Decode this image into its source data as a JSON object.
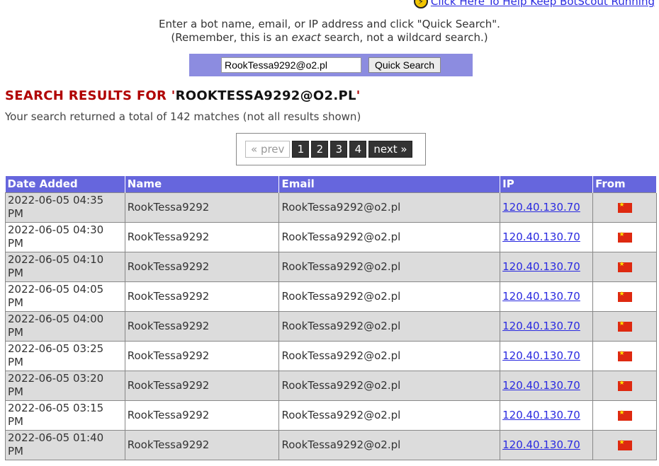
{
  "top": {
    "link_text": "Click Here To Help Keep BotScout Running"
  },
  "instructions": {
    "line1": "Enter a bot name, email, or IP address and click \"Quick Search\".",
    "line2_a": "(Remember, this is an ",
    "line2_em": "exact",
    "line2_b": " search, not a wildcard search.)"
  },
  "search": {
    "value": "RookTessa9292@o2.pl",
    "button_label": "Quick Search"
  },
  "results": {
    "title_label": "SEARCH RESULTS FOR '",
    "title_query": "ROOKTESSA9292@O2.PL",
    "title_end": "'",
    "summary": "Your search returned a total of 142 matches (not all results shown)"
  },
  "pager": {
    "prev": "« prev",
    "pages": [
      "1",
      "2",
      "3",
      "4"
    ],
    "next": "next »"
  },
  "table": {
    "headers": [
      "Date Added",
      "Name",
      "Email",
      "IP",
      "From"
    ],
    "flag_color": "#de2910",
    "rows": [
      {
        "date": "2022-06-05 04:35\nPM",
        "name": "RookTessa9292",
        "email": "RookTessa9292@o2.pl",
        "ip": "120.40.130.70",
        "from": "china-flag-icon"
      },
      {
        "date": "2022-06-05 04:30\nPM",
        "name": "RookTessa9292",
        "email": "RookTessa9292@o2.pl",
        "ip": "120.40.130.70",
        "from": "china-flag-icon"
      },
      {
        "date": "2022-06-05 04:10\nPM",
        "name": "RookTessa9292",
        "email": "RookTessa9292@o2.pl",
        "ip": "120.40.130.70",
        "from": "china-flag-icon"
      },
      {
        "date": "2022-06-05 04:05\nPM",
        "name": "RookTessa9292",
        "email": "RookTessa9292@o2.pl",
        "ip": "120.40.130.70",
        "from": "china-flag-icon"
      },
      {
        "date": "2022-06-05 04:00\nPM",
        "name": "RookTessa9292",
        "email": "RookTessa9292@o2.pl",
        "ip": "120.40.130.70",
        "from": "china-flag-icon"
      },
      {
        "date": "2022-06-05 03:25\nPM",
        "name": "RookTessa9292",
        "email": "RookTessa9292@o2.pl",
        "ip": "120.40.130.70",
        "from": "china-flag-icon"
      },
      {
        "date": "2022-06-05 03:20\nPM",
        "name": "RookTessa9292",
        "email": "RookTessa9292@o2.pl",
        "ip": "120.40.130.70",
        "from": "china-flag-icon"
      },
      {
        "date": "2022-06-05 03:15\nPM",
        "name": "RookTessa9292",
        "email": "RookTessa9292@o2.pl",
        "ip": "120.40.130.70",
        "from": "china-flag-icon"
      },
      {
        "date": "2022-06-05 01:40\nPM",
        "name": "RookTessa9292",
        "email": "RookTessa9292@o2.pl",
        "ip": "120.40.130.70",
        "from": "china-flag-icon"
      }
    ]
  }
}
